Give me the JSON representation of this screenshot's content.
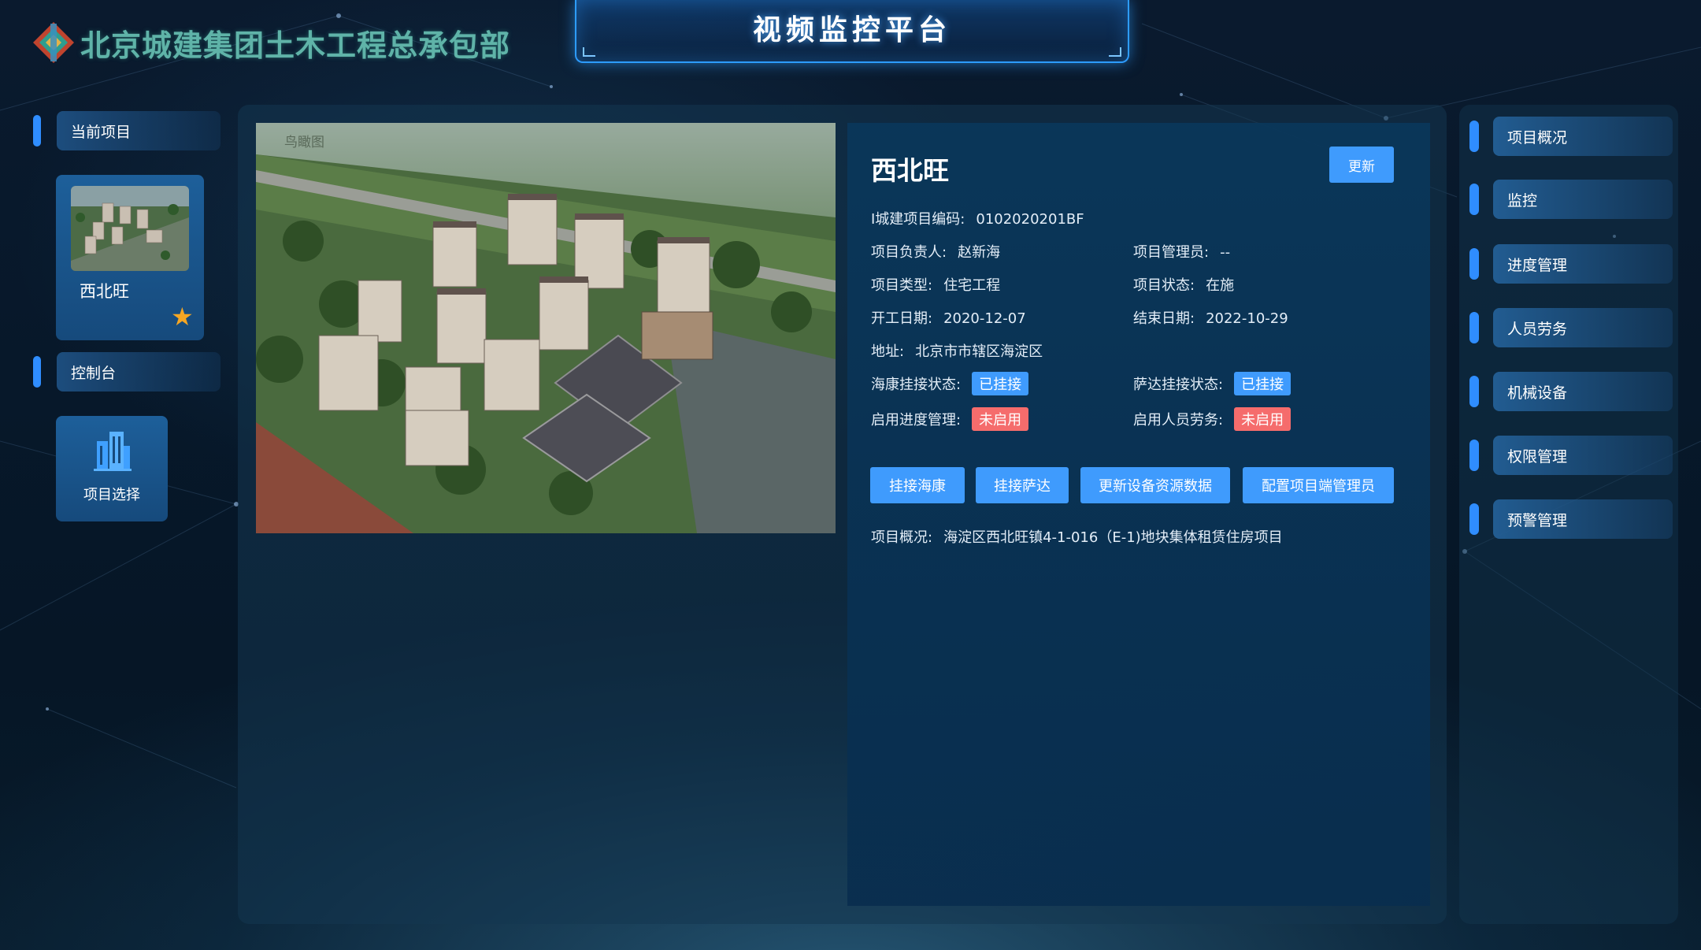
{
  "header": {
    "org_name": "北京城建集团土木工程总承包部",
    "platform_title": "视频监控平台"
  },
  "left_sidebar": {
    "current_project_label": "当前项目",
    "current_project": {
      "name": "西北旺",
      "favorite": true
    },
    "console_label": "控制台",
    "project_select_label": "项目选择"
  },
  "image": {
    "caption": "鸟瞰图"
  },
  "project": {
    "title": "西北旺",
    "update_label": "更新",
    "code_label": "I城建项目编码:",
    "code": "0102020201BF",
    "leader_label": "项目负责人:",
    "leader": "赵新海",
    "admin_label": "项目管理员:",
    "admin": "--",
    "type_label": "项目类型:",
    "type": "住宅工程",
    "status_label": "项目状态:",
    "status": "在施",
    "start_label": "开工日期:",
    "start": "2020-12-07",
    "end_label": "结束日期:",
    "end": "2022-10-29",
    "address_label": "地址:",
    "address": "北京市市辖区海淀区",
    "hikvision_label": "海康挂接状态:",
    "hikvision": "已挂接",
    "sada_label": "萨达挂接状态:",
    "sada": "已挂接",
    "progress_label": "启用进度管理:",
    "progress": "未启用",
    "labor_label": "启用人员劳务:",
    "labor": "未启用",
    "overview_label": "项目概况:",
    "overview": "海淀区西北旺镇4-1-016（E-1)地块集体租赁住房项目"
  },
  "actions": {
    "hikvision": "挂接海康",
    "sada": "挂接萨达",
    "refresh_devices": "更新设备资源数据",
    "config_admin": "配置项目端管理员"
  },
  "right_menu": [
    {
      "label": "项目概况"
    },
    {
      "label": "监控"
    },
    {
      "label": "进度管理"
    },
    {
      "label": "人员劳务"
    },
    {
      "label": "机械设备"
    },
    {
      "label": "权限管理"
    },
    {
      "label": "预警管理"
    }
  ],
  "colors": {
    "accent": "#3f9bfd",
    "danger": "#f56c6c",
    "star": "#f5a623",
    "logo_text": "#5fb3a8"
  }
}
